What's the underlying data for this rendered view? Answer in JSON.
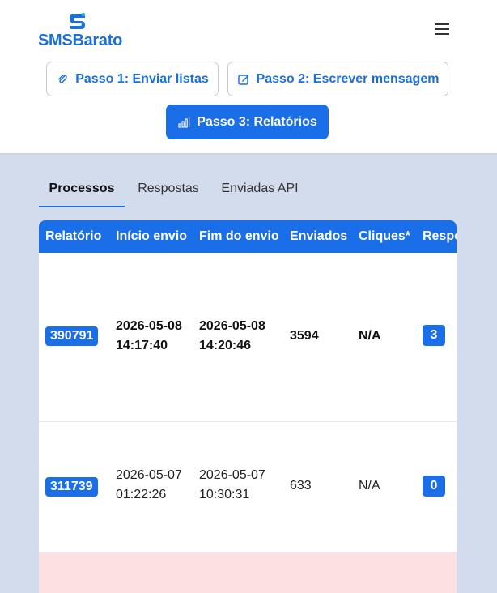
{
  "brand": {
    "name": "SMSBarato",
    "logo_icon": "logo-icon",
    "color": "#1a6fd9"
  },
  "header": {
    "menu_icon": "hamburger-icon"
  },
  "steps": [
    {
      "label": "Passo 1: Enviar listas",
      "icon": "paperclip-icon"
    },
    {
      "label": "Passo 2: Escrever mensagem",
      "icon": "edit-icon"
    },
    {
      "label": "Passo 3: Relatórios",
      "icon": "bar-chart-icon",
      "active": true
    }
  ],
  "tabs": [
    {
      "label": "Processos",
      "active": true
    },
    {
      "label": "Respostas"
    },
    {
      "label": "Enviadas API"
    }
  ],
  "table": {
    "headers": [
      "Relatório",
      "Início envio",
      "Fim do envio",
      "Enviados",
      "Cliques*",
      "Respo"
    ],
    "rows": [
      {
        "id": "390791",
        "start_date": "2026-05-08",
        "start_time": "14:17:40",
        "end_date": "2026-05-08",
        "end_time": "14:20:46",
        "sent": "3594",
        "clicks": "N/A",
        "responses": "3"
      },
      {
        "id": "311739",
        "start_date": "2026-05-07",
        "start_time": "01:22:26",
        "end_date": "2026-05-07",
        "end_time": "10:30:31",
        "sent": "633",
        "clicks": "N/A",
        "responses": "0"
      }
    ]
  },
  "colors": {
    "primary": "#1a6fe8",
    "page_bg": "#d3dcec",
    "highlight_row": "#fde1e2"
  }
}
